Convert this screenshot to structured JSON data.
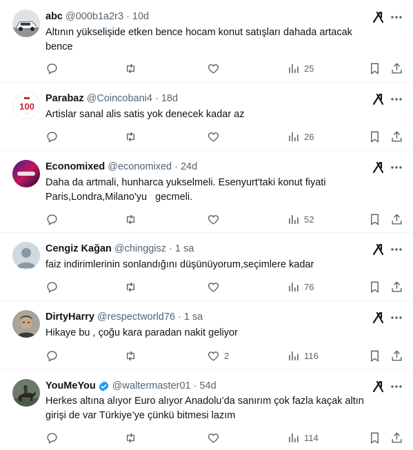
{
  "tweets": [
    {
      "name": "abc",
      "handle": "@000b1a2r3",
      "time": "10d",
      "text": "Altının yükselişide etken bence hocam konut satışları dahada artacak\nbence",
      "likes": "",
      "views": "25",
      "avatar_icon": "car-photo-icon"
    },
    {
      "name": "Parabaz",
      "handle": "@Coincobani4",
      "time": "18d",
      "text": "Artislar sanal alis satis yok denecek kadar az",
      "likes": "",
      "views": "26",
      "avatar_icon": "100-logo-icon"
    },
    {
      "name": "Economixed",
      "handle": "@economixed",
      "time": "24d",
      "text": "Daha da artmali, hunharca yukselmeli. Esenyurt'taki konut fiyati\nParis,Londra,Milano'yu   gecmeli.",
      "likes": "",
      "views": "52",
      "avatar_icon": "gradient-logo-icon"
    },
    {
      "name": "Cengiz Kağan",
      "handle": "@chinggisz",
      "time": "1 sa",
      "text": "faiz indirimlerinin sonlandığını düşünüyorum,seçimlere kadar",
      "likes": "",
      "views": "76",
      "avatar_icon": "default-avatar-icon"
    },
    {
      "name": "DirtyHarry",
      "handle": "@respectworld76",
      "time": "1 sa",
      "text": "Hikaye bu , çoğu kara paradan nakit geliyor",
      "likes": "2",
      "views": "116",
      "avatar_icon": "man-portrait-icon"
    },
    {
      "name": "YouMeYou",
      "handle": "@waltermaster01",
      "time": "54d",
      "text": "Herkes altına alıyor Euro alıyor Anadolu’da sanırım çok fazla kaçak altın\ngirişi de var Türkiye’ye çünkü bitmesi lazım",
      "likes": "",
      "views": "114",
      "avatar_icon": "horse-rider-icon",
      "verified": true
    }
  ],
  "colors": {
    "text": "#0f1419",
    "muted": "#536471",
    "verified": "#1d9bf0",
    "divider": "#eff3f4"
  }
}
